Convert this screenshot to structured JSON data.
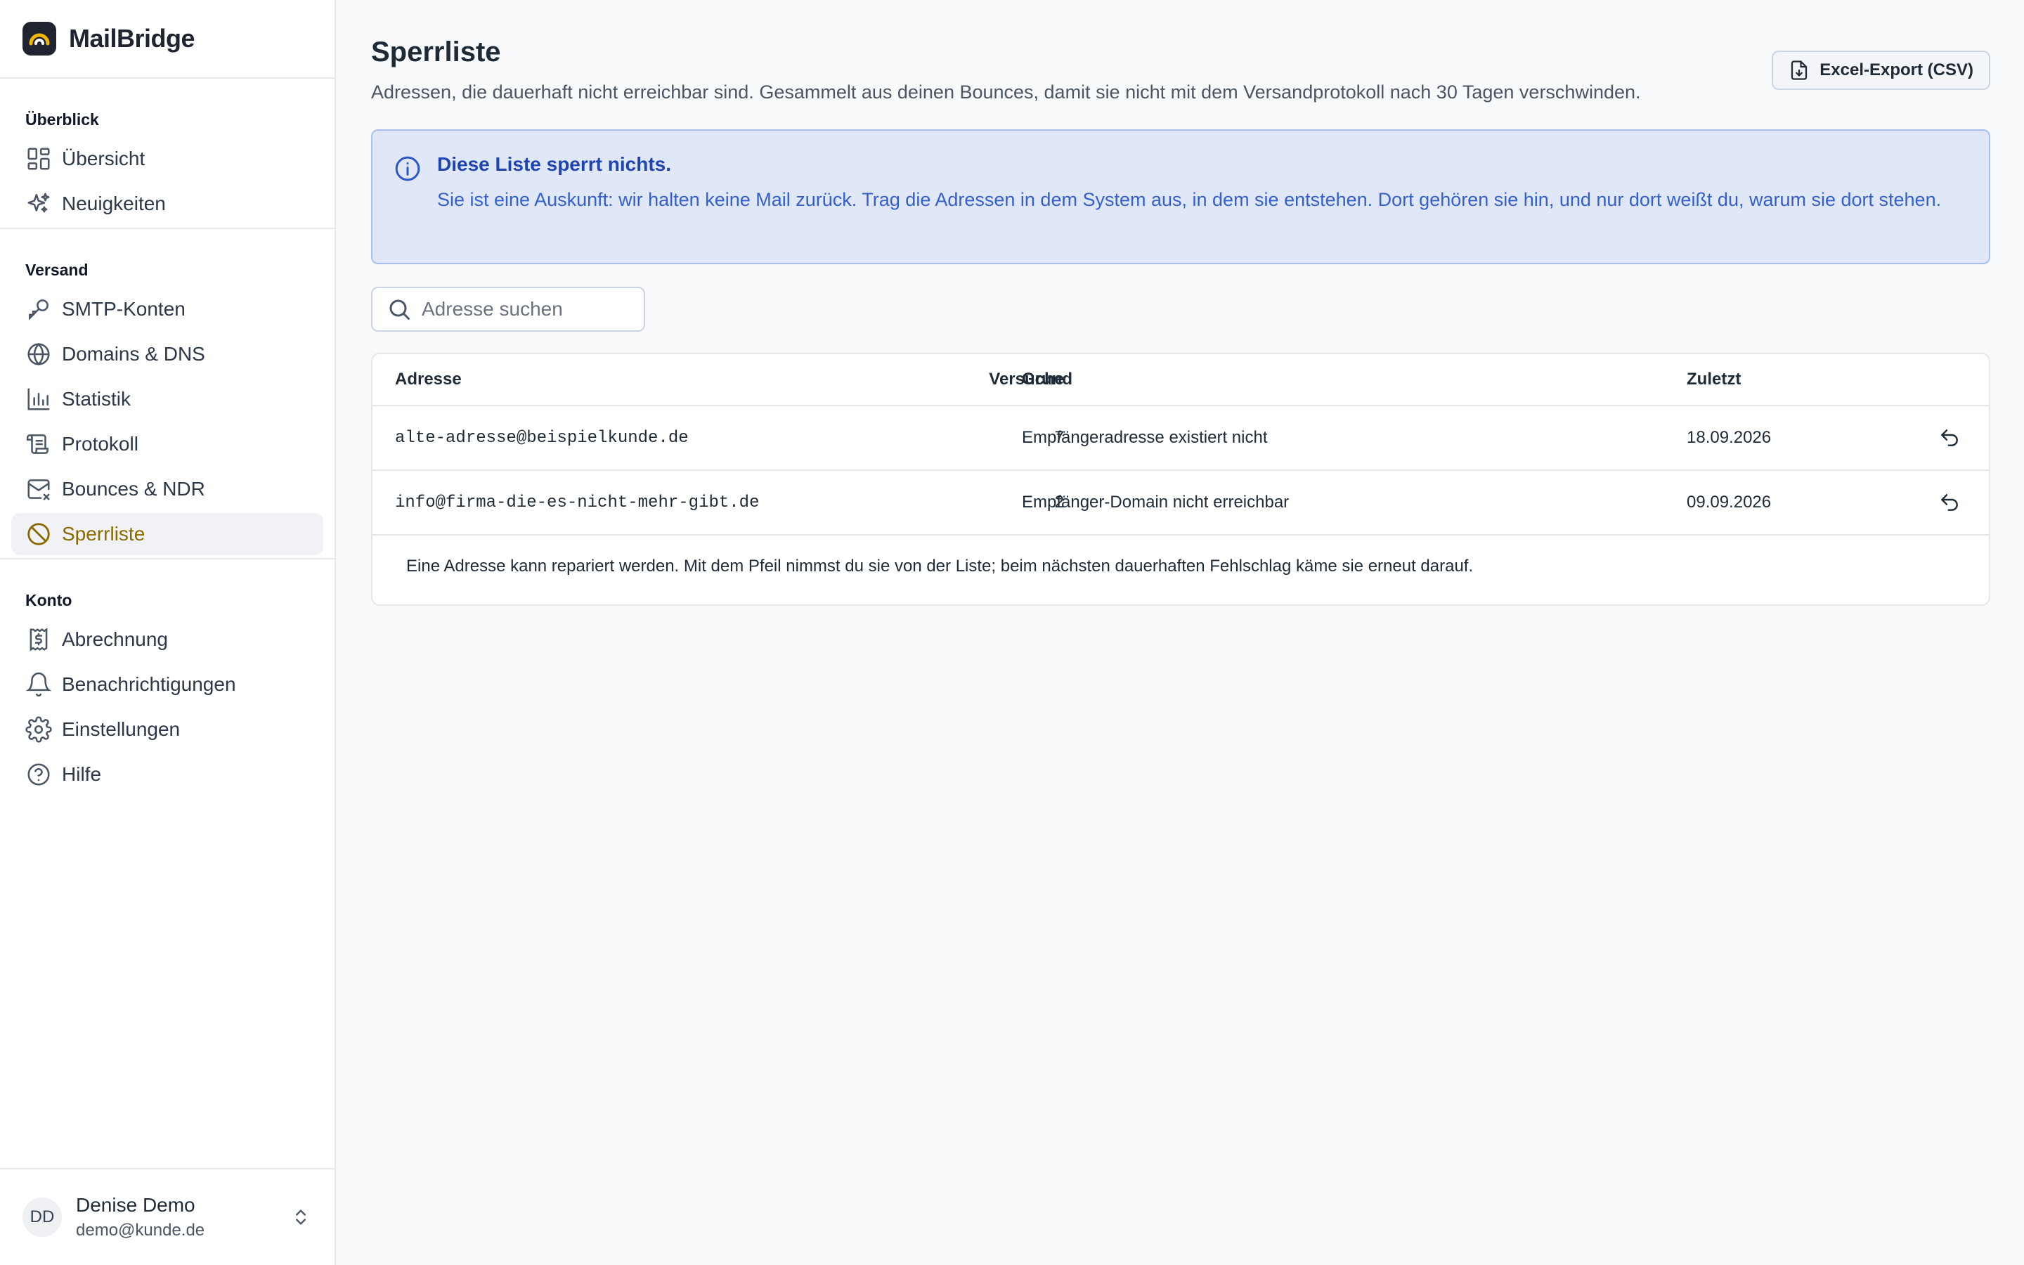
{
  "brand": {
    "name": "MailBridge"
  },
  "sidebar": {
    "sections": [
      {
        "heading": "Überblick",
        "items": [
          {
            "label": "Übersicht",
            "icon": "dashboard-icon"
          },
          {
            "label": "Neuigkeiten",
            "icon": "sparkles-icon"
          }
        ]
      },
      {
        "heading": "Versand",
        "items": [
          {
            "label": "SMTP-Konten",
            "icon": "key-icon"
          },
          {
            "label": "Domains & DNS",
            "icon": "globe-icon"
          },
          {
            "label": "Statistik",
            "icon": "bar-chart-icon"
          },
          {
            "label": "Protokoll",
            "icon": "scroll-icon"
          },
          {
            "label": "Bounces & NDR",
            "icon": "mail-x-icon"
          },
          {
            "label": "Sperrliste",
            "icon": "ban-icon",
            "active": true
          }
        ]
      },
      {
        "heading": "Konto",
        "items": [
          {
            "label": "Abrechnung",
            "icon": "receipt-icon"
          },
          {
            "label": "Benachrichtigungen",
            "icon": "bell-icon"
          },
          {
            "label": "Einstellungen",
            "icon": "gear-icon"
          },
          {
            "label": "Hilfe",
            "icon": "help-circle-icon"
          }
        ]
      }
    ]
  },
  "user": {
    "initials": "DD",
    "name": "Denise Demo",
    "email": "demo@kunde.de"
  },
  "page": {
    "title": "Sperrliste",
    "subtitle": "Adressen, die dauerhaft nicht erreichbar sind. Gesammelt aus deinen Bounces, damit sie nicht mit dem Versandprotokoll nach 30 Tagen verschwinden.",
    "export_label": "Excel-Export (CSV)"
  },
  "info": {
    "title": "Diese Liste sperrt nichts.",
    "text": "Sie ist eine Auskunft: wir halten keine Mail zurück. Trag die Adressen in dem System aus, in dem sie entstehen. Dort gehören sie hin, und nur dort weißt du, warum sie dort stehen."
  },
  "search": {
    "placeholder": "Adresse suchen",
    "value": ""
  },
  "table": {
    "columns": {
      "address": "Adresse",
      "reason": "Grund",
      "tries": "Versuche",
      "last": "Zuletzt"
    },
    "rows": [
      {
        "address": "alte-adresse@beispielkunde.de",
        "reason": "Empfängeradresse existiert nicht",
        "tries": "7",
        "last": "18.09.2026"
      },
      {
        "address": "info@firma-die-es-nicht-mehr-gibt.de",
        "reason": "Empfänger-Domain nicht erreichbar",
        "tries": "2",
        "last": "09.09.2026"
      }
    ],
    "note": "Eine Adresse kann repariert werden. Mit dem Pfeil nimmst du sie von der Liste; beim nächsten dauerhaften Fehlschlag käme sie erneut darauf."
  },
  "colors": {
    "accent_active": "#8a6a00",
    "info_bg": "#e0e8f8",
    "info_text": "#2b56c5"
  }
}
